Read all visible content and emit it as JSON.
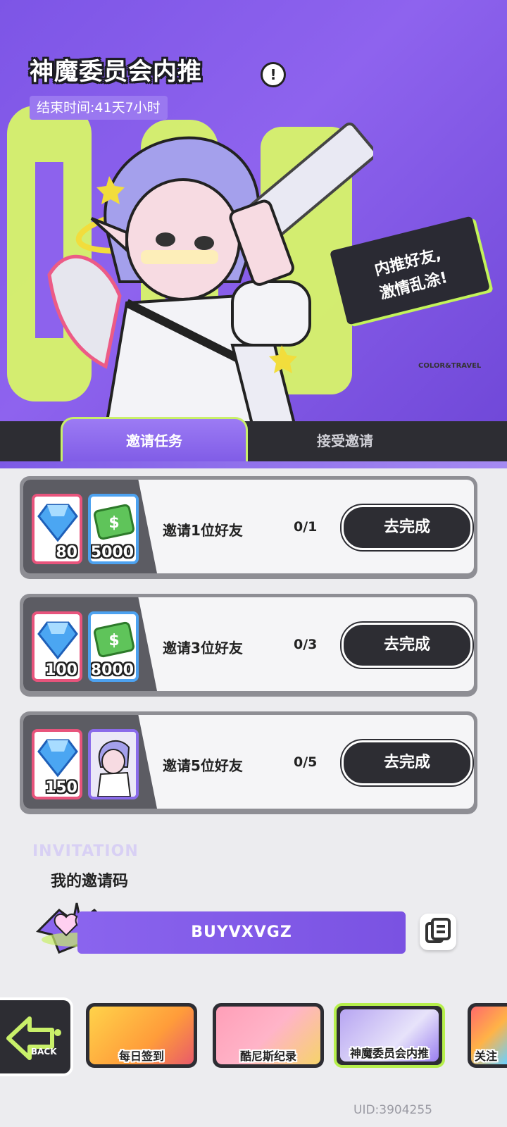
{
  "header": {
    "title": "神魔委员会内推",
    "end_time": "结束时间:41天7小时",
    "info_icon": "exclamation-icon",
    "speech_line1": "内推好友,",
    "speech_line2": "激情乱涂!",
    "brand": "COLOR&TRAVEL"
  },
  "tabs": [
    {
      "label": "邀请任务",
      "active": true
    },
    {
      "label": "接受邀请",
      "active": false
    }
  ],
  "tasks": [
    {
      "label": "邀请1位好友",
      "progress": "0/1",
      "button": "去完成",
      "rewards": [
        {
          "icon": "diamond-icon",
          "qty": "80"
        },
        {
          "icon": "cash-icon",
          "qty": "5000"
        }
      ]
    },
    {
      "label": "邀请3位好友",
      "progress": "0/3",
      "button": "去完成",
      "rewards": [
        {
          "icon": "diamond-icon",
          "qty": "100"
        },
        {
          "icon": "cash-icon",
          "qty": "8000"
        }
      ]
    },
    {
      "label": "邀请5位好友",
      "progress": "0/5",
      "button": "去完成",
      "rewards": [
        {
          "icon": "diamond-icon",
          "qty": "150"
        },
        {
          "icon": "character-avatar-icon",
          "qty": ""
        }
      ]
    }
  ],
  "invite": {
    "deco_text": "INVITATION",
    "label": "我的邀请码",
    "code": "BUYVXVGZ",
    "copy_icon": "copy-icon"
  },
  "bottom_nav": {
    "back_label": "BACK",
    "items": [
      {
        "label": "每日签到",
        "active": false
      },
      {
        "label": "酷尼斯纪录",
        "active": false
      },
      {
        "label": "神魔委员会内推",
        "active": true
      },
      {
        "label": "关注",
        "active": false
      }
    ]
  },
  "footer": {
    "uid": "UID:3904255"
  },
  "colors": {
    "accent_purple": "#8a64ee",
    "accent_lime": "#c9f06a",
    "dark": "#2d2d33"
  }
}
